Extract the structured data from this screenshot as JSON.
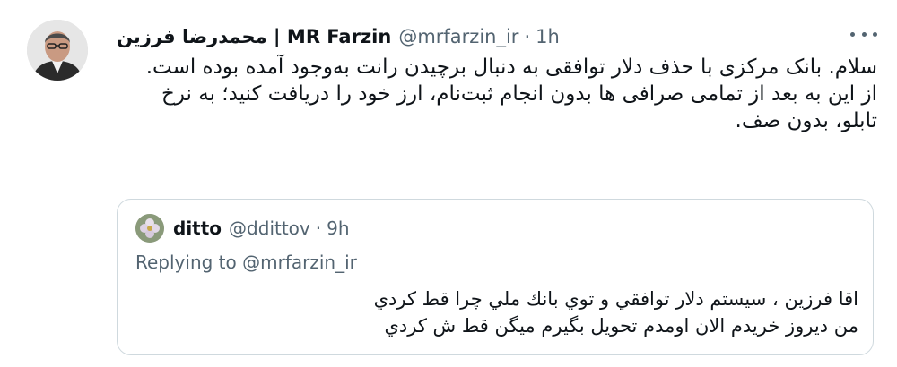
{
  "tweet": {
    "author_name": "محمدرضا فرزین | MR Farzin",
    "author_handle": "@mrfarzin_ir",
    "separator": "·",
    "time": "1h",
    "more_icon": "more-horizontal-icon",
    "text_lines": [
      "سلام. بانک مرکزی با حذف دلار توافقی به دنبال برچیدن رانت به‌وجود آمده بوده است.",
      "از این به بعد از تمامی صرافی ها بدون انجام ثبت‌نام، ارز خود را دریافت کنید؛ به نرخ تابلو، بدون صف."
    ]
  },
  "quote": {
    "author_name": "ditto",
    "author_handle": "@ddittov",
    "separator": "·",
    "time": "9h",
    "replying_prefix": "Replying to ",
    "replying_to": "@mrfarzin_ir",
    "text_lines": [
      "اقا فرزين ، سيستم دلار توافقي و توي بانك ملي چرا قط كردي",
      "من ديروز خريدم الان اومدم تحويل بگيرم ميگن قط ش كردي"
    ]
  }
}
